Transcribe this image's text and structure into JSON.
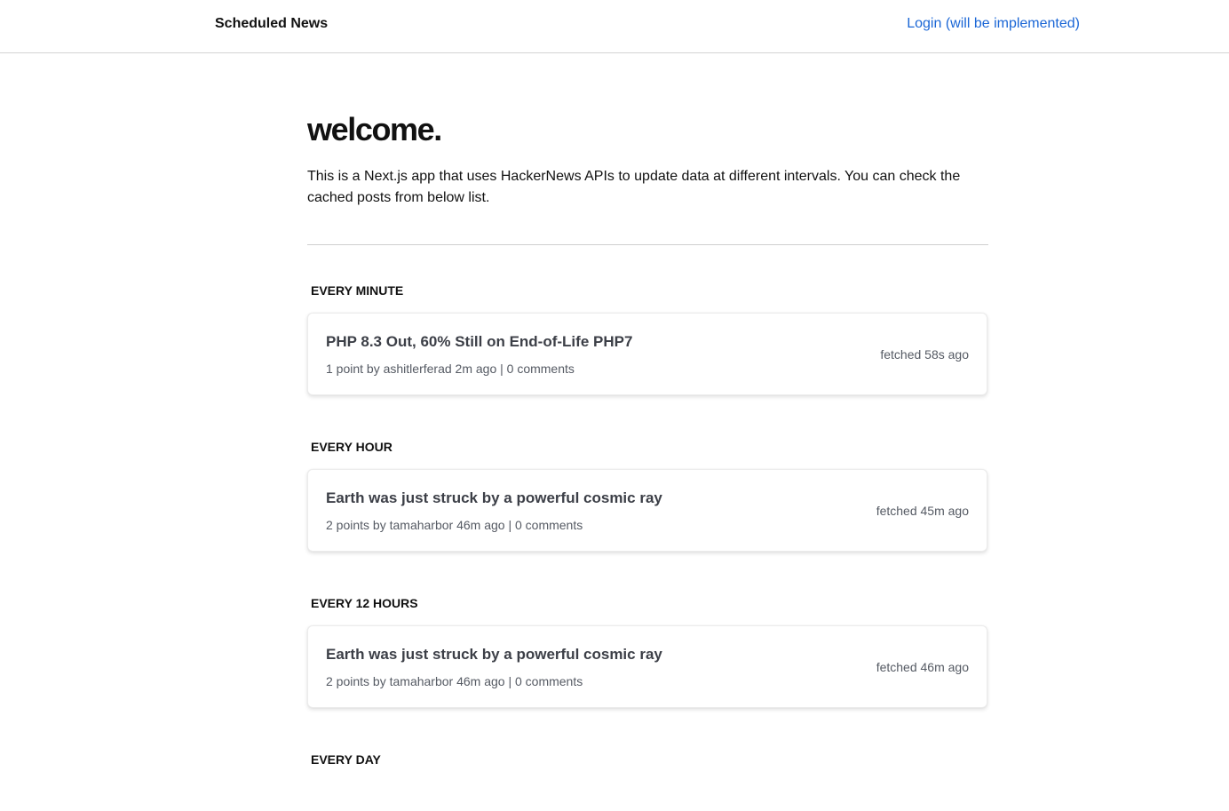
{
  "header": {
    "brand": "Scheduled News",
    "login": "Login (will be implemented)"
  },
  "main": {
    "heading": "welcome.",
    "intro": "This is a Next.js app that uses HackerNews APIs to update data at different intervals. You can check the cached posts from below list."
  },
  "sections": [
    {
      "title": "EVERY MINUTE",
      "post": {
        "title": "PHP 8.3 Out, 60% Still on End-of-Life PHP7",
        "meta": "1 point by ashitlerferad 2m ago | 0 comments",
        "fetched": "fetched 58s ago"
      }
    },
    {
      "title": "EVERY HOUR",
      "post": {
        "title": "Earth was just struck by a powerful cosmic ray",
        "meta": "2 points by tamaharbor 46m ago | 0 comments",
        "fetched": "fetched 45m ago"
      }
    },
    {
      "title": "EVERY 12 HOURS",
      "post": {
        "title": "Earth was just struck by a powerful cosmic ray",
        "meta": "2 points by tamaharbor 46m ago | 0 comments",
        "fetched": "fetched 46m ago"
      }
    },
    {
      "title": "EVERY DAY"
    }
  ]
}
